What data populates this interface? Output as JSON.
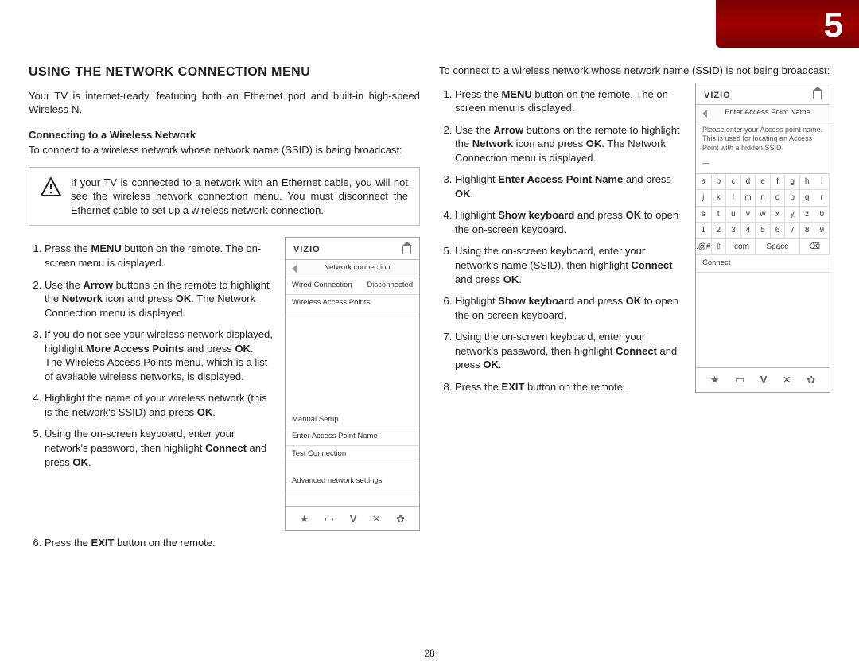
{
  "chapter": "5",
  "page_number": "28",
  "left": {
    "heading": "USING THE NETWORK CONNECTION MENU",
    "intro": "Your TV is internet-ready, featuring both an Ethernet port and built-in high-speed Wireless-N.",
    "subheading": "Connecting to a Wireless Network",
    "subintro": "To connect to a wireless network whose network name (SSID) is being broadcast:",
    "warning": "If your TV is connected to a network with an Ethernet cable, you will not see the wireless network connection menu. You must disconnect the Ethernet cable to set up a wireless network connection."
  },
  "tv1": {
    "brand": "VIZIO",
    "title": "Network connection",
    "row1a": "Wired Connection",
    "row1b": "Disconnected",
    "row2": "Wireless Access Points",
    "opt1": "Manual Setup",
    "opt2": "Enter Access Point Name",
    "opt3": "Test Connection",
    "opt4": "Advanced network settings"
  },
  "right": {
    "intro": "To connect to a wireless network whose network name (SSID) is not being broadcast:"
  },
  "tv2": {
    "brand": "VIZIO",
    "title": "Enter Access Point Name",
    "help": "Please enter your Access point name. This is used for locating an Access Point with a hidden SSID",
    "connect": "Connect",
    "key_atsign": ".@#",
    "key_shift": "⇧",
    "key_com": ".com",
    "key_space": "Space",
    "key_bksp": "⌫"
  }
}
